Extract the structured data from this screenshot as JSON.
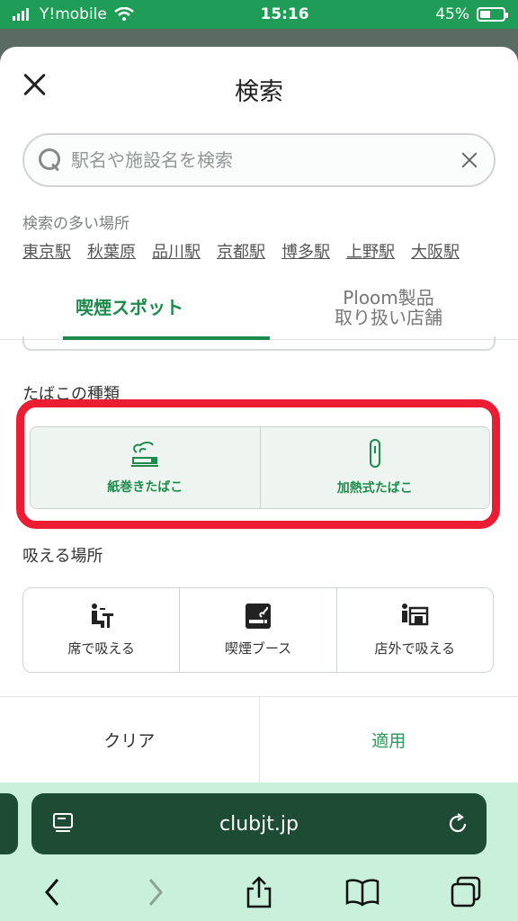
{
  "status": {
    "carrier": "Y!mobile",
    "time": "15:16",
    "battery": "45%",
    "battery_level": 0.45
  },
  "sheet": {
    "title": "検索",
    "search_placeholder": "駅名や施設名を検索",
    "popular": {
      "label": "検索の多い場所",
      "items": [
        "東京駅",
        "秋葉原",
        "品川駅",
        "京都駅",
        "博多駅",
        "上野駅",
        "大阪駅"
      ]
    },
    "tabs": [
      {
        "label": "喫煙スポット",
        "active": true
      },
      {
        "label": "Ploom製品\n取り扱い店舗",
        "active": false
      }
    ],
    "tobacco": {
      "label": "たばこの種類",
      "options": [
        "紙巻きたばこ",
        "加熱式たばこ"
      ]
    },
    "places": {
      "label": "吸える場所",
      "options": [
        "席で吸える",
        "喫煙ブース",
        "店外で吸える"
      ]
    },
    "footer": {
      "clear": "クリア",
      "apply": "適用"
    },
    "accent": "#1e8a4c",
    "highlight": "#ec1c33"
  },
  "browser": {
    "url": "clubjt.jp"
  }
}
